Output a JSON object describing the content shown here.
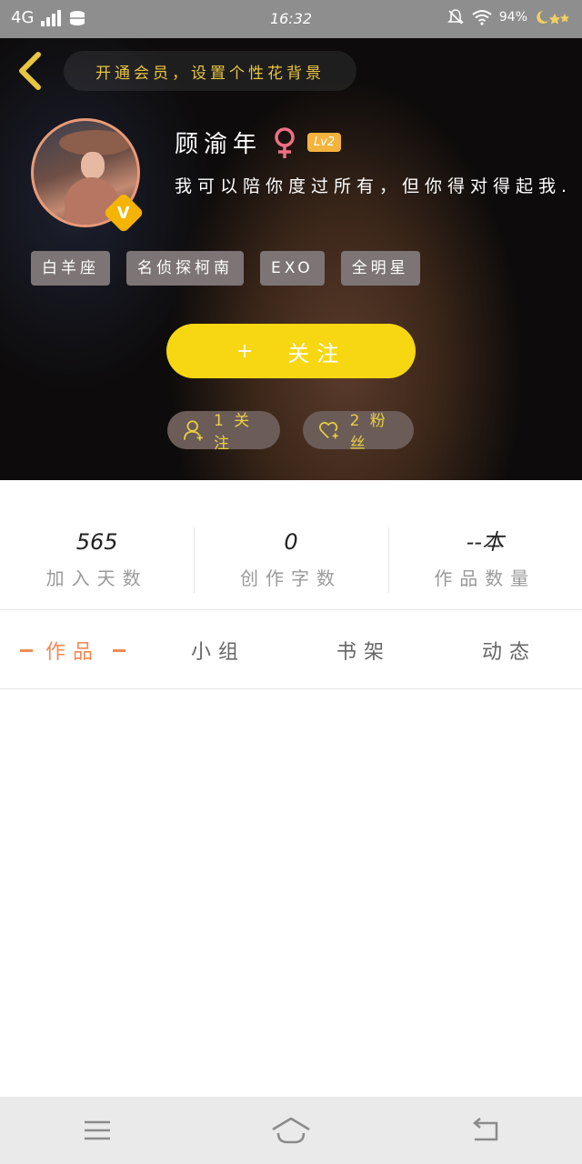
{
  "status_bar": {
    "network": "4G",
    "time": "16:32",
    "battery": "94%"
  },
  "header": {
    "vip_banner": "开通会员，设置个性花背景"
  },
  "profile": {
    "name": "顾渝年",
    "level": "Lv2",
    "badge": "V",
    "signature": "我可以陪你度过所有，但你得对得起我.",
    "tags": [
      "白羊座",
      "名侦探柯南",
      "EXO",
      "全明星"
    ]
  },
  "actions": {
    "follow_plus": "+",
    "follow_label": "关注",
    "following": "1 关注",
    "fans": "2 粉丝"
  },
  "stats": [
    {
      "value": "565",
      "label": "加入天数"
    },
    {
      "value": "0",
      "label": "创作字数"
    },
    {
      "value": "--本",
      "label": "作品数量"
    }
  ],
  "tabs": [
    {
      "label": "作品",
      "active": true
    },
    {
      "label": "小组",
      "active": false
    },
    {
      "label": "书架",
      "active": false
    },
    {
      "label": "动态",
      "active": false
    }
  ],
  "colors": {
    "accent": "#ef8a55",
    "follow": "#f7d712",
    "gold": "#e9cf43"
  }
}
